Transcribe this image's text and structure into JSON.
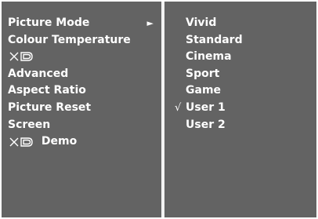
{
  "menu": {
    "items": [
      {
        "label": "Picture Mode",
        "has_submenu": true,
        "arrow": "►"
      },
      {
        "label": "Colour Temperature"
      },
      {
        "label": "",
        "logo": "XD"
      },
      {
        "label": "Advanced"
      },
      {
        "label": "Aspect Ratio"
      },
      {
        "label": "Picture Reset"
      },
      {
        "label": "Screen"
      },
      {
        "label": "Demo",
        "logo": "XD"
      }
    ]
  },
  "submenu": {
    "options": [
      {
        "label": "Vivid"
      },
      {
        "label": "Standard"
      },
      {
        "label": "Cinema"
      },
      {
        "label": "Sport"
      },
      {
        "label": "Game"
      },
      {
        "label": "User 1",
        "selected": true,
        "check": "√"
      },
      {
        "label": "User 2"
      }
    ]
  },
  "colors": {
    "panel_background": "#636363",
    "divider": "#f2f2f2",
    "text": "#ffffff"
  }
}
